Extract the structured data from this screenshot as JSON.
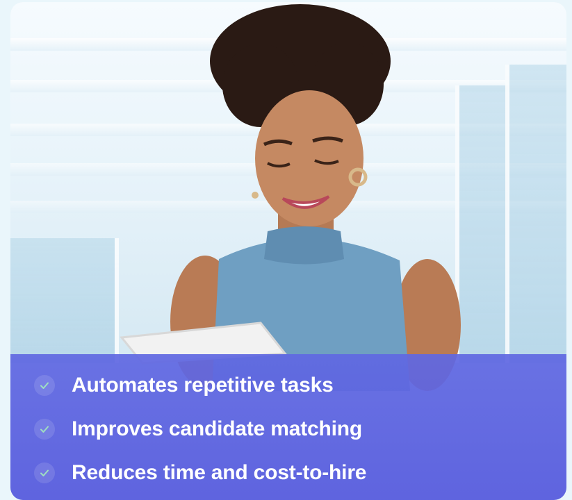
{
  "hero_image": {
    "subject": "smiling-woman-with-tablet",
    "overlay_color": "#5f66e2"
  },
  "benefits": {
    "items": [
      {
        "label": "Automates repetitive tasks",
        "icon": "check-icon"
      },
      {
        "label": "Improves candidate matching",
        "icon": "check-icon"
      },
      {
        "label": "Reduces time and cost-to-hire",
        "icon": "check-icon"
      }
    ]
  }
}
